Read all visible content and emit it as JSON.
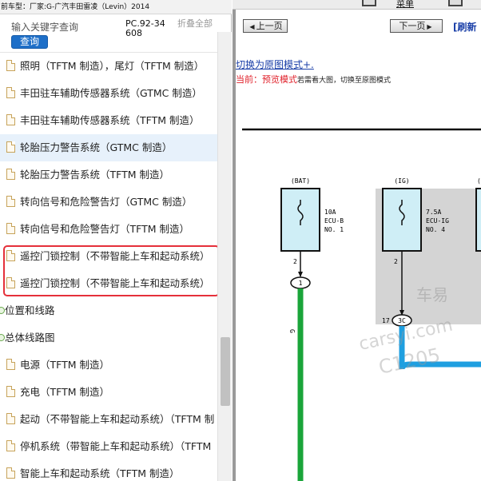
{
  "vehicle_bar": "前车型：厂家:G-广汽丰田雷凌（Levin）2014",
  "search": {
    "placeholder": "输入关键字查询",
    "button_label": "查询",
    "code_label": "PC.92-34608",
    "collapse_label": "折叠全部"
  },
  "tree": {
    "items": [
      {
        "type": "doc",
        "label": "照明（TFTM 制造），尾灯（TFTM 制造）"
      },
      {
        "type": "doc",
        "label": "丰田驻车辅助传感器系统（GTMC 制造）"
      },
      {
        "type": "doc",
        "label": "丰田驻车辅助传感器系统（TFTM 制造）"
      },
      {
        "type": "doc",
        "label": "轮胎压力警告系统（GTMC 制造）",
        "selected": true
      },
      {
        "type": "doc",
        "label": "轮胎压力警告系统（TFTM 制造）"
      },
      {
        "type": "doc",
        "label": "转向信号和危险警告灯（GTMC 制造）"
      },
      {
        "type": "doc",
        "label": "转向信号和危险警告灯（TFTM 制造）"
      },
      {
        "type": "doc",
        "label": "遥控门锁控制（不带智能上车和起动系统）"
      },
      {
        "type": "doc",
        "label": "遥控门锁控制（不带智能上车和起动系统）"
      },
      {
        "type": "folder",
        "label": "位置和线路"
      },
      {
        "type": "folder",
        "label": "总体线路图"
      },
      {
        "type": "doc",
        "label": "电源（TFTM 制造）"
      },
      {
        "type": "doc",
        "label": "充电（TFTM 制造）"
      },
      {
        "type": "doc",
        "label": "起动（不带智能上车和起动系统）（TFTM 制"
      },
      {
        "type": "doc",
        "label": "停机系统（带智能上车和起动系统）（TFTM"
      },
      {
        "type": "doc",
        "label": "智能上车和起动系统（TFTM 制造）"
      }
    ]
  },
  "toolbar": {
    "menu_label": "菜单",
    "prev_label": "上一页",
    "next_label": "下一页",
    "refresh_label": "[刷新"
  },
  "viewer": {
    "switch_link": "切换为原图模式+.",
    "status_prefix": "当前：预览模式",
    "status_suffix": "若需看大图，切换至原图模式"
  },
  "diagram": {
    "fuses": [
      {
        "source": "(BAT)",
        "rating": "10A",
        "name": "ECU-B",
        "number": "NO. 1",
        "pin": "2",
        "connector": "1"
      },
      {
        "source": "(IG)",
        "rating": "7.5A",
        "name": "ECU-IG",
        "number": "NO. 4",
        "pin": "2",
        "connector": "3C",
        "connector_pin": "17"
      }
    ],
    "partial_source": "(",
    "wire_label": "G",
    "watermark": [
      "车易",
      "carsyi.com",
      "C1205"
    ],
    "colors": {
      "green_wire": "#1aa53a",
      "blue_wire": "#1f9fe0",
      "fuse_fill": "#cfeef6",
      "ig_area": "#d4d4d4"
    }
  }
}
